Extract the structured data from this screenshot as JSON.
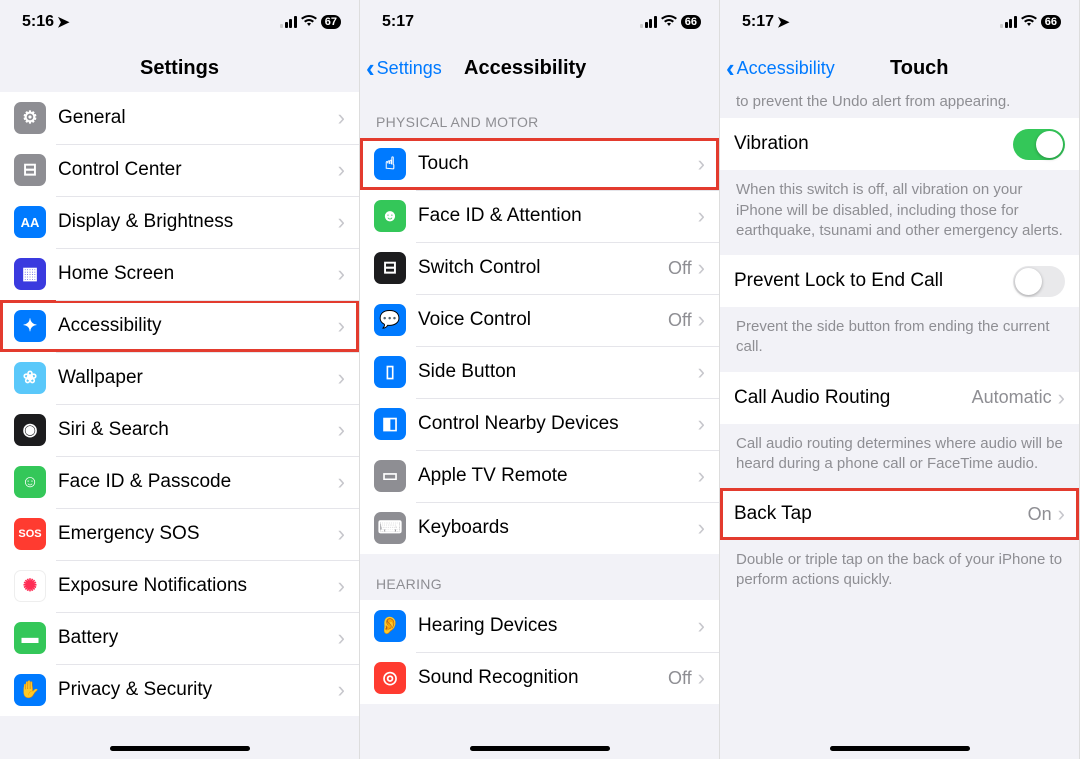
{
  "panel1": {
    "status": {
      "time": "5:16",
      "battery": "67"
    },
    "nav": {
      "title": "Settings"
    },
    "rows": [
      {
        "label": "General"
      },
      {
        "label": "Control Center"
      },
      {
        "label": "Display & Brightness"
      },
      {
        "label": "Home Screen"
      },
      {
        "label": "Accessibility"
      },
      {
        "label": "Wallpaper"
      },
      {
        "label": "Siri & Search"
      },
      {
        "label": "Face ID & Passcode"
      },
      {
        "label": "Emergency SOS"
      },
      {
        "label": "Exposure Notifications"
      },
      {
        "label": "Battery"
      },
      {
        "label": "Privacy & Security"
      }
    ]
  },
  "panel2": {
    "status": {
      "time": "5:17",
      "battery": "66"
    },
    "nav": {
      "back": "Settings",
      "title": "Accessibility"
    },
    "sections": {
      "physical_motor": "PHYSICAL AND MOTOR",
      "hearing": "HEARING"
    },
    "rows_pm": [
      {
        "label": "Touch"
      },
      {
        "label": "Face ID & Attention"
      },
      {
        "label": "Switch Control",
        "value": "Off"
      },
      {
        "label": "Voice Control",
        "value": "Off"
      },
      {
        "label": "Side Button"
      },
      {
        "label": "Control Nearby Devices"
      },
      {
        "label": "Apple TV Remote"
      },
      {
        "label": "Keyboards"
      }
    ],
    "rows_hear": [
      {
        "label": "Hearing Devices"
      },
      {
        "label": "Sound Recognition",
        "value": "Off"
      }
    ]
  },
  "panel3": {
    "status": {
      "time": "5:17",
      "battery": "66"
    },
    "nav": {
      "back": "Accessibility",
      "title": "Touch"
    },
    "partial_footer": "to prevent the Undo alert from appearing.",
    "vibration": {
      "label": "Vibration",
      "on": true
    },
    "vibration_footer": "When this switch is off, all vibration on your iPhone will be disabled, including those for earthquake, tsunami and other emergency alerts.",
    "prevent_lock": {
      "label": "Prevent Lock to End Call",
      "on": false
    },
    "prevent_lock_footer": "Prevent the side button from ending the current call.",
    "call_audio": {
      "label": "Call Audio Routing",
      "value": "Automatic"
    },
    "call_audio_footer": "Call audio routing determines where audio will be heard during a phone call or FaceTime audio.",
    "back_tap": {
      "label": "Back Tap",
      "value": "On"
    },
    "back_tap_footer": "Double or triple tap on the back of your iPhone to perform actions quickly."
  },
  "icons": {
    "general": "⚙︎",
    "control_center": "⊟",
    "display": "AA",
    "home": "▦",
    "accessibility": "⊛",
    "wallpaper": "❀",
    "siri": "◉",
    "faceid": "☺",
    "sos": "SOS",
    "exposure": "✺",
    "battery": "▬",
    "privacy": "✋",
    "touch": "☝︎",
    "faceid_att": "☻",
    "switch": "⊟",
    "voice": "💬",
    "side": "📱",
    "nearby": "◧",
    "appletv": "▭",
    "keyboards": "⌨︎",
    "hearing": "👂",
    "sound": "◎"
  },
  "colors": {
    "gray": "#8e8e93",
    "blue": "#007aff",
    "green": "#34c759",
    "red": "#ff3b30",
    "orange": "#ff9500",
    "teal": "#5ac8fa",
    "darkgray": "#6d6d72",
    "pink": "#ff2d55",
    "purple": "#5856d6"
  }
}
